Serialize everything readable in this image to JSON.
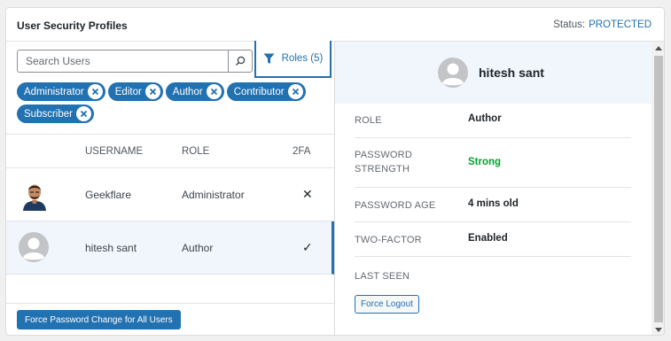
{
  "header": {
    "title": "User Security Profiles",
    "status_label": "Status:",
    "status_value": "PROTECTED"
  },
  "search": {
    "placeholder": "Search Users",
    "value": ""
  },
  "roles_filter": {
    "label": "Roles (5)"
  },
  "chips": [
    "Administrator",
    "Editor",
    "Author",
    "Contributor",
    "Subscriber"
  ],
  "table": {
    "columns": {
      "username": "USERNAME",
      "role": "ROLE",
      "twofa": "2FA"
    },
    "rows": [
      {
        "username": "Geekflare",
        "role": "Administrator",
        "twofa": "✕"
      },
      {
        "username": "hitesh sant",
        "role": "Author",
        "twofa": "✓"
      }
    ]
  },
  "footer": {
    "force_all_label": "Force Password Change for All Users"
  },
  "profile": {
    "name": "hitesh sant",
    "details": {
      "role_label": "ROLE",
      "role_value": "Author",
      "strength_label": "PASSWORD STRENGTH",
      "strength_value": "Strong",
      "age_label": "PASSWORD AGE",
      "age_value": "4 mins old",
      "twofactor_label": "TWO-FACTOR",
      "twofactor_value": "Enabled",
      "lastseen_label": "LAST SEEN",
      "lastseen_value": ""
    },
    "force_logout_label": "Force Logout"
  },
  "colors": {
    "accent": "#2271b1",
    "success": "#00a32a",
    "selected_bg": "#f0f6fc"
  }
}
